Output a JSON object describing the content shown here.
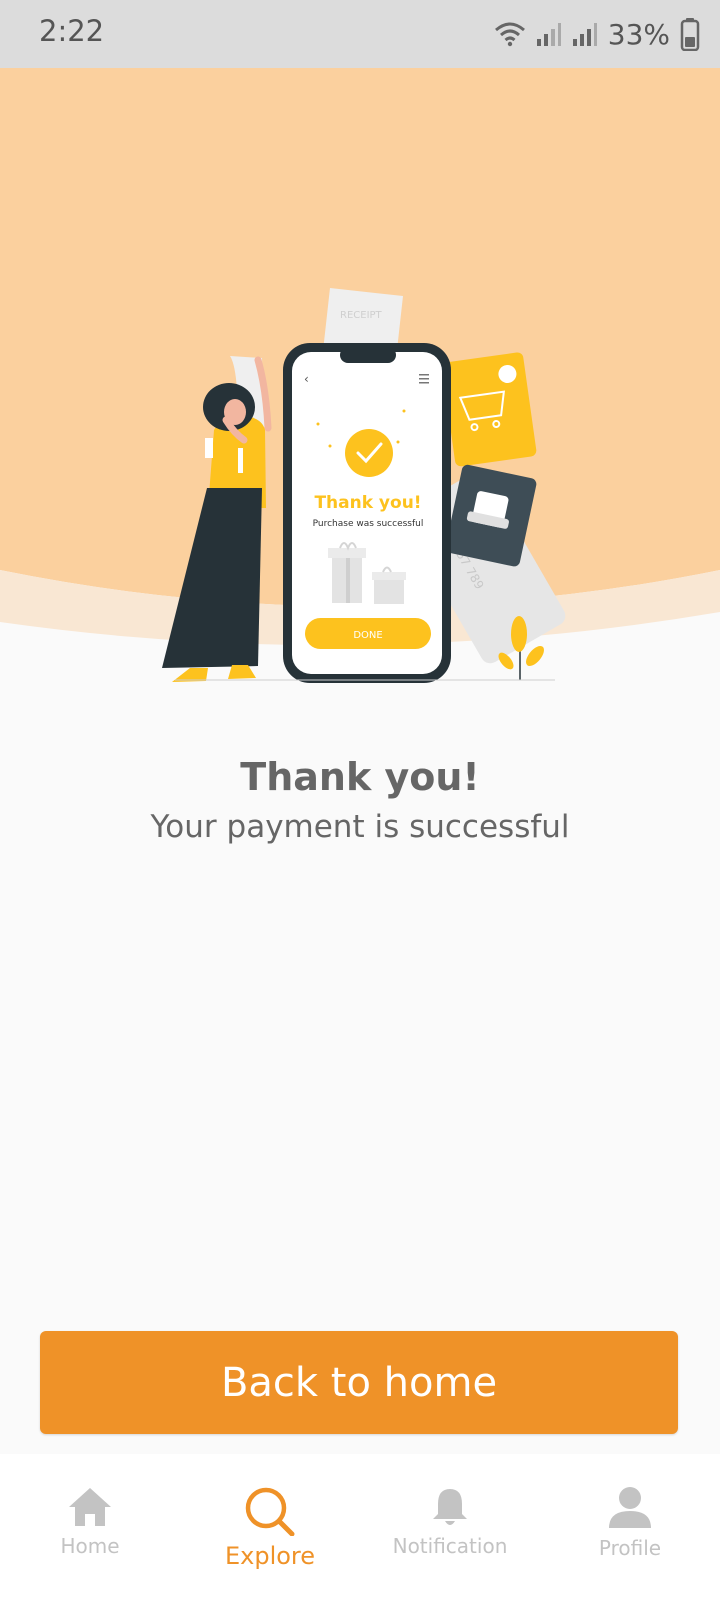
{
  "status_bar": {
    "time": "2:22",
    "battery": "33%"
  },
  "illustration": {
    "receipt_text": "RECEIPT",
    "phone_title": "Thank you!",
    "phone_subtitle": "Purchase was successful",
    "phone_button": "DONE",
    "card_number": "56 357 789",
    "colors": {
      "accent": "#fdc21e",
      "dark": "#263238",
      "bg": "#fbd09e"
    }
  },
  "message": {
    "title": "Thank you!",
    "subtitle": "Your payment is successful"
  },
  "back_button": {
    "label": "Back to home",
    "color": "#ef9228"
  },
  "bottom_nav": {
    "active": "Explore",
    "items": [
      {
        "label": "Home",
        "icon": "home-icon"
      },
      {
        "label": "Explore",
        "icon": "search-icon"
      },
      {
        "label": "Notification",
        "icon": "bell-icon"
      },
      {
        "label": "Profile",
        "icon": "person-icon"
      }
    ]
  }
}
